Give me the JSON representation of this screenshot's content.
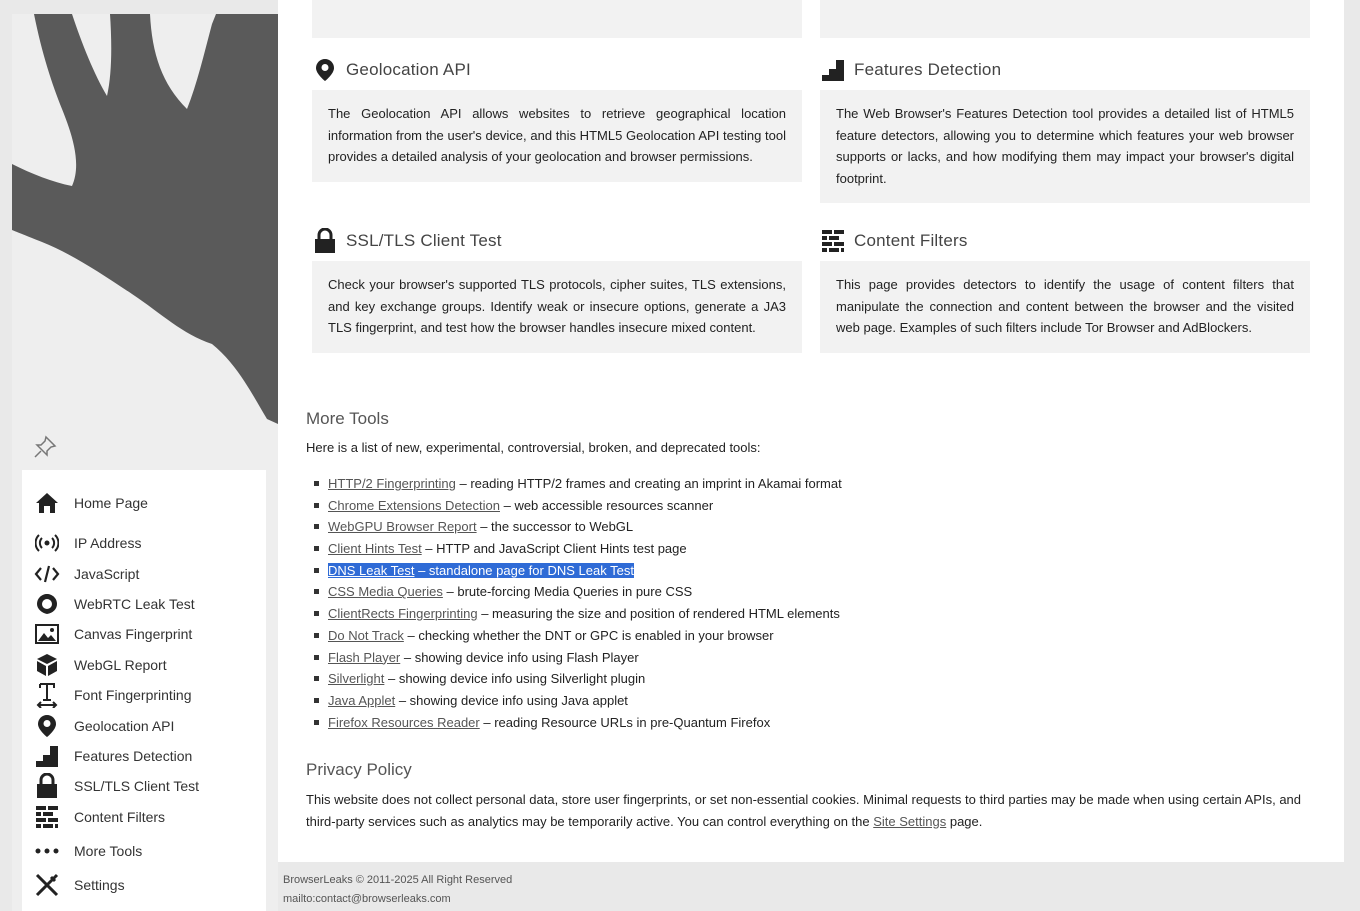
{
  "sidebar": {
    "items": [
      {
        "label": "Home Page",
        "icon": "home-icon"
      },
      {
        "label": "IP Address",
        "icon": "broadcast-icon"
      },
      {
        "label": "JavaScript",
        "icon": "code-icon"
      },
      {
        "label": "WebRTC Leak Test",
        "icon": "webrtc-icon"
      },
      {
        "label": "Canvas Fingerprint",
        "icon": "image-icon"
      },
      {
        "label": "WebGL Report",
        "icon": "cube-icon"
      },
      {
        "label": "Font Fingerprinting",
        "icon": "text-cursor-icon"
      },
      {
        "label": "Geolocation API",
        "icon": "map-pin-icon"
      },
      {
        "label": "Features Detection",
        "icon": "bar-steps-icon"
      },
      {
        "label": "SSL/TLS Client Test",
        "icon": "lock-icon"
      },
      {
        "label": "Content Filters",
        "icon": "brick-wall-icon"
      },
      {
        "label": "More Tools",
        "icon": "dots-icon"
      },
      {
        "label": "Settings",
        "icon": "tools-icon"
      }
    ]
  },
  "cards": {
    "geolocation": {
      "title": "Geolocation API",
      "body": "The Geolocation API allows websites to retrieve geographical location information from the user's device, and this HTML5 Geolocation API testing tool provides a detailed analysis of your geolocation and browser permissions."
    },
    "features": {
      "title": "Features Detection",
      "body": "The Web Browser's Features Detection tool provides a detailed list of HTML5 feature detectors, allowing you to determine which features your web browser supports or lacks, and how modifying them may impact your browser's digital footprint."
    },
    "ssl": {
      "title": "SSL/TLS Client Test",
      "body": "Check your browser's supported TLS protocols, cipher suites, TLS extensions, and key exchange groups. Identify weak or insecure options, generate a JA3 TLS fingerprint, and test how the browser handles insecure mixed content."
    },
    "filters": {
      "title": "Content Filters",
      "body": "This page provides detectors to identify the usage of content filters that manipulate the connection and content between the browser and the visited web page. Examples of such filters include Tor Browser and AdBlockers."
    }
  },
  "more_tools": {
    "title": "More Tools",
    "intro": "Here is a list of new, experimental, controversial, broken, and deprecated tools:",
    "items": [
      {
        "link": "HTTP/2 Fingerprinting",
        "desc": " – reading HTTP/2 frames and creating an imprint in Akamai format"
      },
      {
        "link": "Chrome Extensions Detection",
        "desc": " – web accessible resources scanner"
      },
      {
        "link": "WebGPU Browser Report",
        "desc": " – the successor to WebGL"
      },
      {
        "link": "Client Hints Test",
        "desc": " – HTTP and JavaScript Client Hints test page"
      },
      {
        "link": "DNS Leak Test",
        "desc": " – standalone page for DNS Leak Test"
      },
      {
        "link": "CSS Media Queries",
        "desc": " – brute-forcing Media Queries in pure CSS"
      },
      {
        "link": "ClientRects Fingerprinting",
        "desc": " – measuring the size and position of rendered HTML elements"
      },
      {
        "link": "Do Not Track",
        "desc": " – checking whether the DNT or GPC is enabled in your browser"
      },
      {
        "link": "Flash Player",
        "desc": " – showing device info using Flash Player"
      },
      {
        "link": "Silverlight",
        "desc": " – showing device info using Silverlight plugin"
      },
      {
        "link": "Java Applet",
        "desc": " – showing device info using Java applet"
      },
      {
        "link": "Firefox Resources Reader",
        "desc": " – reading Resource URLs in pre-Quantum Firefox"
      }
    ]
  },
  "privacy": {
    "title": "Privacy Policy",
    "text_before": "This website does not collect personal data, store user fingerprints, or set non-essential cookies. Minimal requests to third parties may be made when using certain APIs, and third-party services such as analytics may be temporarily active. You can control everything on the ",
    "link": "Site Settings",
    "text_after": " page."
  },
  "footer": {
    "copyright": "BrowserLeaks © 2011-2025 All Right Reserved",
    "contact": "mailto:contact@browserleaks.com"
  }
}
